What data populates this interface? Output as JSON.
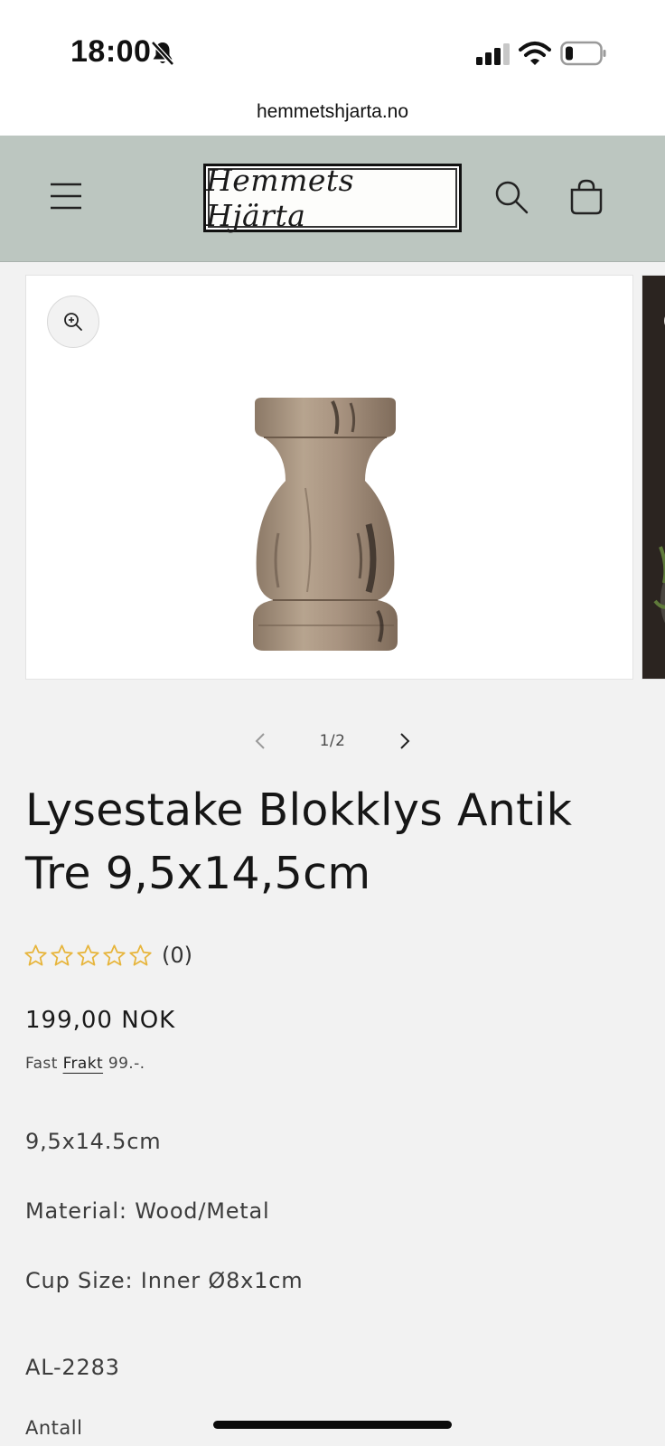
{
  "status_bar": {
    "time": "18:00"
  },
  "browser": {
    "url": "hemmetshjarta.no"
  },
  "header": {
    "logo_text": "Hemmets Hjärta"
  },
  "gallery": {
    "counter": "1/2"
  },
  "product": {
    "title": "Lysestake Blokklys Antik Tre 9,5x14,5cm",
    "rating": {
      "stars": 0,
      "max": 5,
      "count_text": "(0)",
      "star_color": "#e7b53c"
    },
    "price": "199,00 NOK",
    "shipping": {
      "prefix": "Fast",
      "link": "Frakt",
      "suffix": "99.-."
    },
    "description": [
      "9,5x14.5cm",
      "Material: Wood/Metal",
      "Cup Size: Inner Ø8x1cm"
    ],
    "sku": "AL-2283",
    "quantity_label": "Antall"
  },
  "colors": {
    "header_bg": "#bcc6c0",
    "page_bg": "#f2f2f2"
  }
}
